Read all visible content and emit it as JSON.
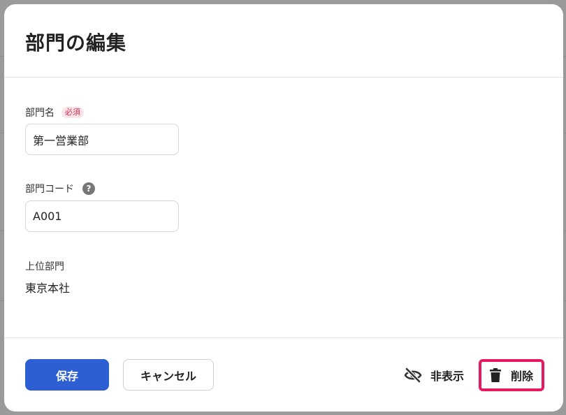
{
  "modal": {
    "title": "部門の編集"
  },
  "form": {
    "department_name": {
      "label": "部門名",
      "required_badge": "必須",
      "value": "第一営業部"
    },
    "department_code": {
      "label": "部門コード",
      "help_icon": "?",
      "value": "A001"
    },
    "parent_department": {
      "label": "上位部門",
      "value": "東京本社"
    }
  },
  "footer": {
    "save_label": "保存",
    "cancel_label": "キャンセル",
    "hide_label": "非表示",
    "hide_icon": "eye-off-icon",
    "delete_label": "削除",
    "delete_icon": "trash-icon"
  },
  "colors": {
    "primary": "#2d5fd2",
    "highlight": "#e8185f",
    "required_text": "#c0334d",
    "required_bg": "#fde4ea"
  }
}
